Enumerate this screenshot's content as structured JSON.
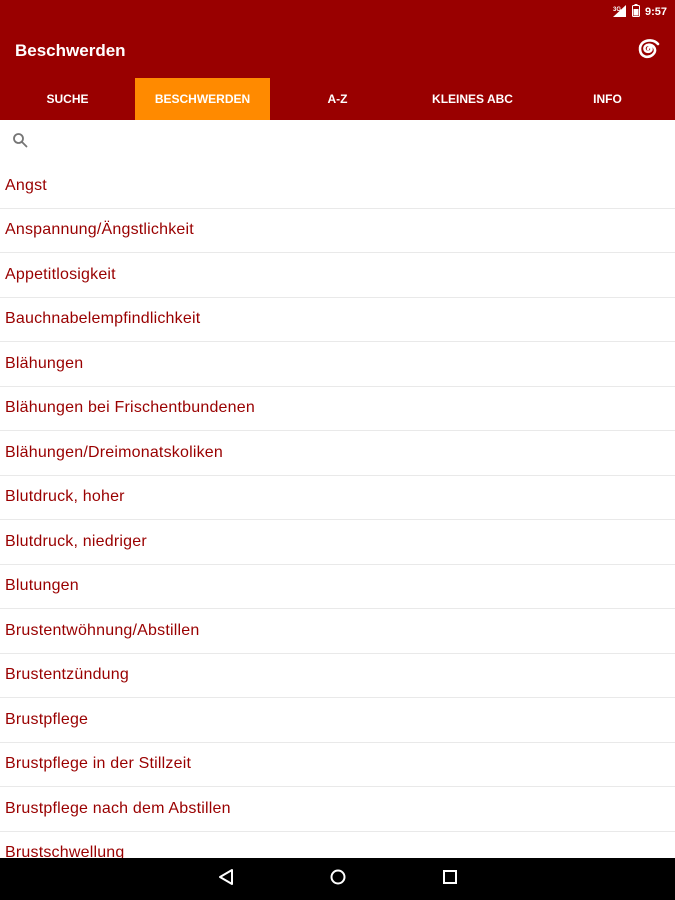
{
  "status_bar": {
    "time": "9:57",
    "icons": [
      "signal-icon",
      "battery-icon"
    ]
  },
  "app_bar": {
    "title": "Beschwerden",
    "action_icon": "spiral-icon"
  },
  "tabs": [
    {
      "label": "SUCHE",
      "active": false
    },
    {
      "label": "BESCHWERDEN",
      "active": true
    },
    {
      "label": "A-Z",
      "active": false
    },
    {
      "label": "KLEINES ABC",
      "active": false
    },
    {
      "label": "INFO",
      "active": false
    }
  ],
  "search": {
    "placeholder": "",
    "value": "",
    "icon": "search-icon"
  },
  "list_items": [
    "Angst",
    "Anspannung/Ängstlichkeit",
    "Appetitlosigkeit",
    "Bauchnabelempfindlichkeit",
    "Blähungen",
    "Blähungen bei Frischentbundenen",
    "Blähungen/Dreimonatskoliken",
    "Blutdruck, hoher",
    "Blutdruck, niedriger",
    "Blutungen",
    "Brustentwöhnung/Abstillen",
    "Brustentzündung",
    "Brustpflege",
    "Brustpflege in der Stillzeit",
    "Brustpflege nach dem Abstillen",
    "Brustschwellung"
  ],
  "nav_bar": {
    "icons": [
      "back-icon",
      "home-icon",
      "recents-icon"
    ]
  },
  "colors": {
    "primary": "#990000",
    "accent": "#ff8a00",
    "text": "#990000",
    "divider": "#e9e9e9"
  }
}
